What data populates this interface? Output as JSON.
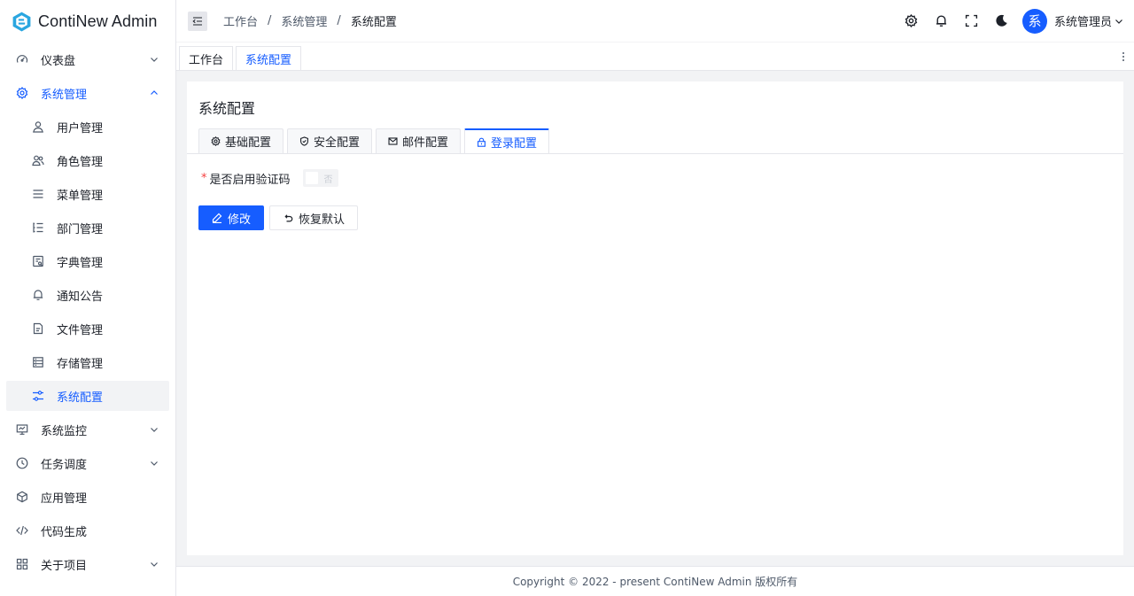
{
  "app": {
    "name": "ContiNew Admin",
    "brand_color": "#165dff"
  },
  "sidebar": {
    "items": [
      {
        "label": "仪表盘",
        "icon": "dashboard-icon",
        "expandable": true
      },
      {
        "label": "系统管理",
        "icon": "gear-icon",
        "expandable": true,
        "expanded": true,
        "children": [
          {
            "label": "用户管理",
            "icon": "user-icon"
          },
          {
            "label": "角色管理",
            "icon": "user-group-icon"
          },
          {
            "label": "菜单管理",
            "icon": "menu-icon"
          },
          {
            "label": "部门管理",
            "icon": "tree-list-icon"
          },
          {
            "label": "字典管理",
            "icon": "dictionary-icon"
          },
          {
            "label": "通知公告",
            "icon": "bell-icon"
          },
          {
            "label": "文件管理",
            "icon": "file-icon"
          },
          {
            "label": "存储管理",
            "icon": "storage-icon"
          },
          {
            "label": "系统配置",
            "icon": "sliders-icon",
            "selected": true
          }
        ]
      },
      {
        "label": "系统监控",
        "icon": "monitor-icon",
        "expandable": true
      },
      {
        "label": "任务调度",
        "icon": "clock-icon",
        "expandable": true
      },
      {
        "label": "应用管理",
        "icon": "cube-icon",
        "expandable": false
      },
      {
        "label": "代码生成",
        "icon": "code-icon",
        "expandable": false
      },
      {
        "label": "关于项目",
        "icon": "apps-icon",
        "expandable": true
      }
    ]
  },
  "header": {
    "breadcrumb": [
      "工作台",
      "系统管理",
      "系统配置"
    ],
    "breadcrumb_sep": "/",
    "avatar_text": "系",
    "username": "系统管理员"
  },
  "page_tabs": [
    {
      "label": "工作台",
      "active": false
    },
    {
      "label": "系统配置",
      "active": true
    }
  ],
  "main": {
    "title": "系统配置",
    "tabs": [
      {
        "label": "基础配置",
        "icon": "gear-icon",
        "active": false
      },
      {
        "label": "安全配置",
        "icon": "shield-icon",
        "active": false
      },
      {
        "label": "邮件配置",
        "icon": "mail-icon",
        "active": false
      },
      {
        "label": "登录配置",
        "icon": "lock-icon",
        "active": true
      }
    ],
    "form": {
      "captcha_label": "是否启用验证码",
      "required_mark": "*",
      "captcha_switch_text": "否",
      "captcha_enabled": false
    },
    "buttons": {
      "edit": "修改",
      "reset": "恢复默认"
    }
  },
  "footer": {
    "text": "Copyright © 2022 - present ContiNew Admin 版权所有"
  }
}
